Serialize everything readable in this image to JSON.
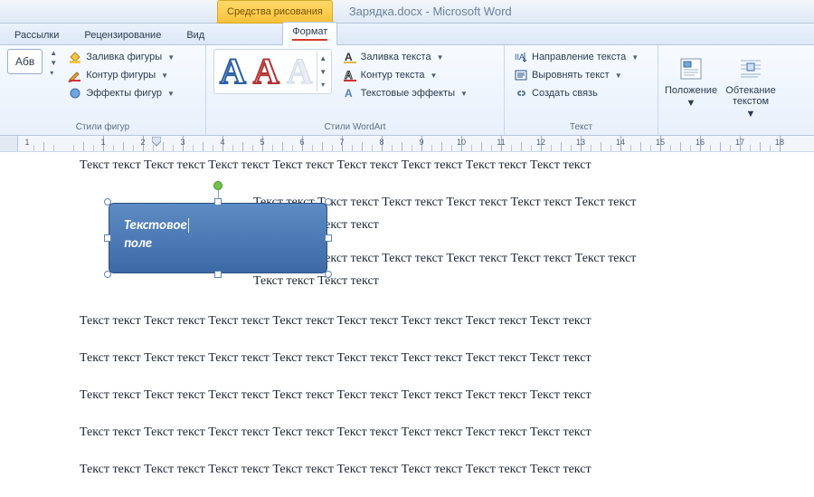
{
  "titlebar": {
    "context_tab": "Средства рисования",
    "document": "Зарядка.docx",
    "app": "Microsoft Word"
  },
  "tabs": {
    "mailings": "Рассылки",
    "review": "Рецензирование",
    "view": "Вид",
    "format": "Формат"
  },
  "ribbon": {
    "shape_styles": {
      "abv": "Абв",
      "fill": "Заливка фигуры",
      "outline": "Контур фигуры",
      "effects": "Эффекты фигур",
      "group_label": "Стили фигур"
    },
    "wordart": {
      "sample": "А",
      "text_fill": "Заливка текста",
      "text_outline": "Контур текста",
      "text_effects": "Текстовые эффекты",
      "group_label": "Стили WordArt"
    },
    "text": {
      "direction": "Направление текста",
      "align": "Выровнять текст",
      "link": "Создать связь",
      "group_label": "Текст"
    },
    "arrange": {
      "position": "Положение",
      "wrap": "Обтекание текстом"
    }
  },
  "ruler": {
    "labels": [
      "1",
      "1",
      "2",
      "3",
      "4",
      "5",
      "6",
      "7",
      "8",
      "9",
      "10",
      "11",
      "12",
      "13",
      "14",
      "15",
      "16",
      "17",
      "18"
    ]
  },
  "document": {
    "line": "Текст текст Текст текст Текст текст Текст текст Текст текст Текст текст Текст текст Текст текст",
    "wrap_line1": "Текст текст Текст текст Текст текст Текст текст Текст текст Текст текст",
    "wrap_line2": "Текст текст Текст текст",
    "shape_text_l1": "Текстовое",
    "shape_text_l2": "поле"
  }
}
